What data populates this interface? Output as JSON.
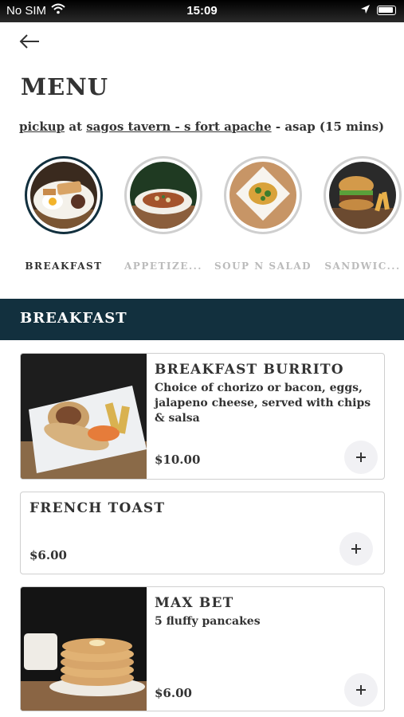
{
  "status_bar": {
    "carrier": "No SIM",
    "time": "15:09",
    "icons": [
      "wifi-icon",
      "location-arrow-icon",
      "battery-icon"
    ]
  },
  "header": {
    "back_icon": "arrow-left-icon",
    "title": "MENU"
  },
  "order": {
    "method": "pickup",
    "at_text": "at",
    "location": "sagos tavern - s fort apache",
    "time_text": "- asap (15 mins)"
  },
  "categories": [
    {
      "label": "BREAKFAST",
      "active": true
    },
    {
      "label": "APPETIZE...",
      "active": false
    },
    {
      "label": "SOUP N SALAD",
      "active": false
    },
    {
      "label": "SANDWIC...",
      "active": false
    }
  ],
  "section": {
    "title": "BREAKFAST"
  },
  "items": [
    {
      "name": "BREAKFAST BURRITO",
      "description": "Choice of chorizo or bacon, eggs, jalapeno cheese, served with chips & salsa",
      "price": "$10.00",
      "add_label": "+"
    },
    {
      "name": "FRENCH TOAST",
      "price": "$6.00",
      "add_label": "+"
    },
    {
      "name": "MAX BET",
      "description": "5 fluffy pancakes",
      "price": "$6.00",
      "add_label": "+"
    }
  ],
  "colors": {
    "header_bg": "#12303e",
    "active_ring": "#12303e",
    "inactive_ring": "#cfcfcf",
    "text": "#333333",
    "inactive_text": "#bbbbbb",
    "add_button_bg": "#f1f1f4"
  }
}
